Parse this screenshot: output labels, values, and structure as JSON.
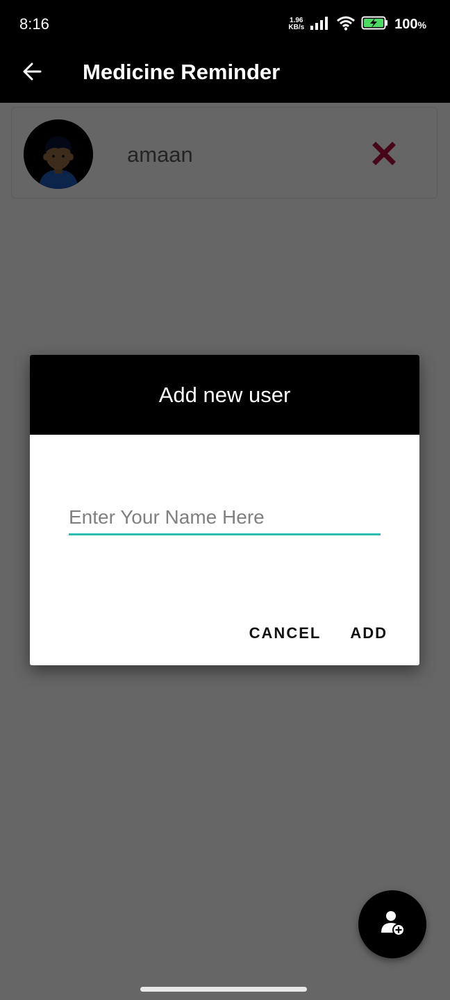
{
  "status_bar": {
    "time": "8:16",
    "net_speed_value": "1.96",
    "net_speed_unit": "KB/s",
    "battery_value": "100",
    "battery_unit": "%",
    "icons": [
      "signal-icon",
      "wifi-icon",
      "battery-charging-icon"
    ]
  },
  "app_bar": {
    "title": "Medicine Reminder",
    "back_icon": "back-arrow-icon"
  },
  "users": [
    {
      "name": "amaan",
      "avatar_icon": "avatar-icon",
      "delete_icon": "delete-x-icon"
    }
  ],
  "dialog": {
    "title": "Add new user",
    "input_placeholder": "Enter Your Name Here",
    "input_value": "",
    "cancel_label": "CANCEL",
    "add_label": "ADD"
  },
  "fab": {
    "icon": "add-user-icon"
  },
  "colors": {
    "bar_background": "#000000",
    "input_underline": "#2bbfb3",
    "delete_icon": "#b5123e",
    "avatar_shirt": "#1e5bb8"
  }
}
